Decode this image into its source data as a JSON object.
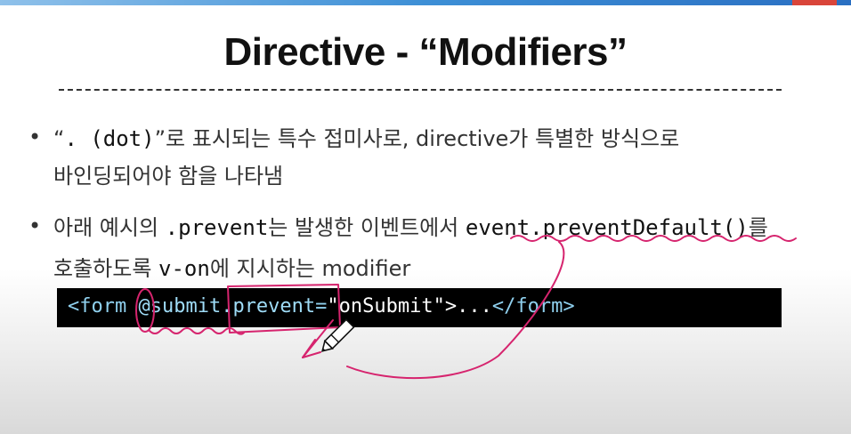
{
  "slide": {
    "title": "Directive - “Modifiers”",
    "bullets": [
      {
        "line1_q1": "“",
        "line1_code": ". (dot)",
        "line1_q2": "”",
        "line1_text": "로 표시되는 특수 접미사로, directive가 특별한 방식으로",
        "line2": "바인딩되어야 함을 나타냄"
      },
      {
        "line1_a": "아래 예시의 ",
        "line1_code1": ".prevent",
        "line1_b": "는 발생한 이벤트에서 ",
        "line1_code2": "event.preventDefault()",
        "line1_c": "를",
        "line2_a": "호출하도록 ",
        "line2_code": "v-on",
        "line2_b": "에 지시하는 modifier"
      }
    ],
    "bullet_symbol": "•",
    "code": {
      "open_tag": "<form ",
      "attr": "@submit.prevent",
      "eq": "=",
      "value": "\"onSubmit\"",
      "middle": ">...",
      "close_tag": "</form>"
    }
  },
  "colors": {
    "annotation": "#d6246e",
    "code_background": "#000000",
    "code_text": "#9bd6f1"
  }
}
